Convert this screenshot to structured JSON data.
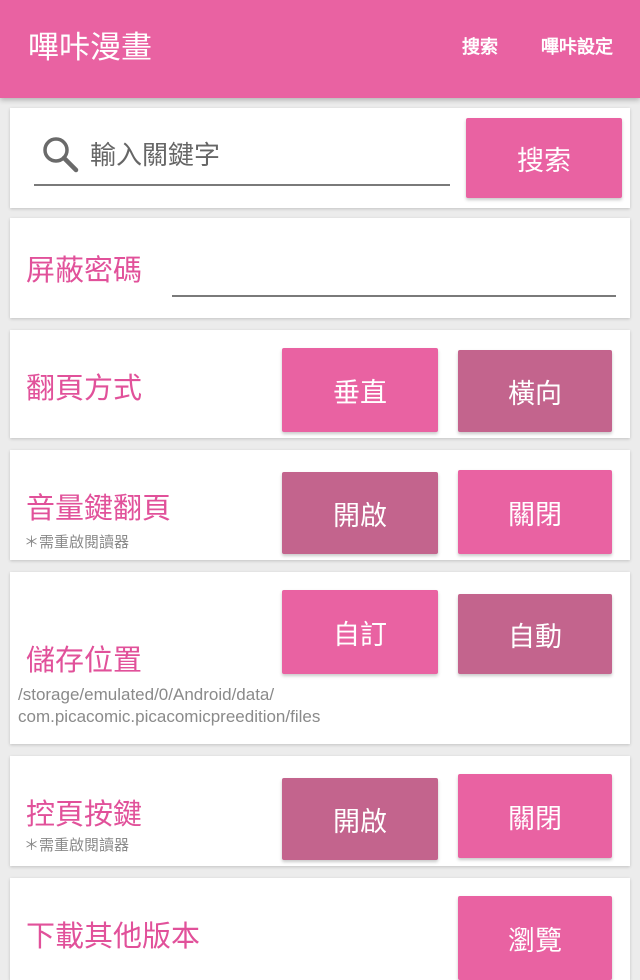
{
  "appbar": {
    "title": "嗶咔漫畫",
    "search_action": "搜索",
    "settings_action": "嗶咔設定"
  },
  "search": {
    "placeholder": "輸入關鍵字",
    "button": "搜索"
  },
  "password": {
    "label": "屏蔽密碼",
    "value": ""
  },
  "page_turn": {
    "label": "翻頁方式",
    "options": [
      "垂直",
      "橫向"
    ],
    "selected": "垂直"
  },
  "volume_key": {
    "label": "音量鍵翻頁",
    "note": "＊需重啟閱讀器",
    "options": [
      "開啟",
      "關閉"
    ],
    "selected": "關閉"
  },
  "storage": {
    "label": "儲存位置",
    "options": [
      "自訂",
      "自動"
    ],
    "selected": "自訂",
    "path_line1": "/storage/emulated/0/Android/data/",
    "path_line2": "com.picacomic.picacomicpreedition/files"
  },
  "control_key": {
    "label": "控頁按鍵",
    "note": "＊需重啟閱讀器",
    "options": [
      "開啟",
      "關閉"
    ],
    "selected": "關閉"
  },
  "other_versions": {
    "label": "下載其他版本",
    "button": "瀏覽"
  },
  "colors": {
    "accent": "#e962a2",
    "accent_dark": "#c3648d",
    "label_pink": "#e1519a",
    "background": "#ececec"
  }
}
